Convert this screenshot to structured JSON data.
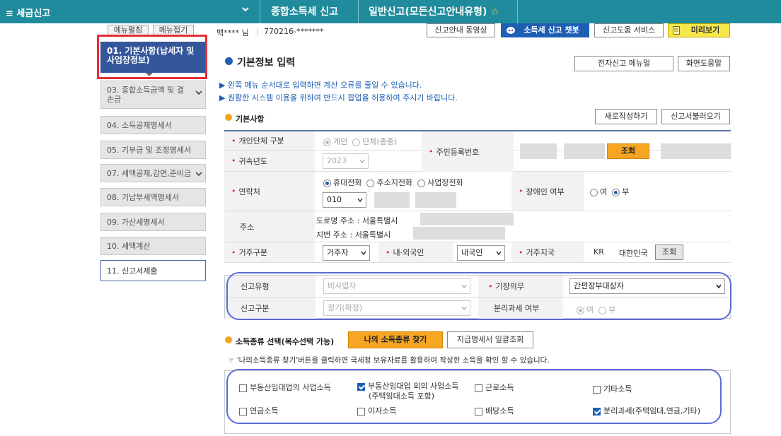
{
  "topbar": {
    "menu_label": "≡  세금신고",
    "crumb1": "종합소득세 신고",
    "crumb2": "일반신고(모든신고안내유형)",
    "star": "☆"
  },
  "sidebar": {
    "top_btn1": "메뉴펼침",
    "top_btn2": "메뉴접기",
    "items": [
      {
        "label": "01. 기본사항(납세자 및 사업장정보)"
      },
      {
        "label": "03. 종합소득금액 및 결손금"
      },
      {
        "label": "04. 소득공제명세서"
      },
      {
        "label": "05. 기부금 및 조정명세서"
      },
      {
        "label": "07. 세액공제,감면,준비금"
      },
      {
        "label": "08. 기납부세액명세서"
      },
      {
        "label": "09. 가산세명세서"
      },
      {
        "label": "10. 세액계산"
      },
      {
        "label": "11. 신고서제출"
      }
    ]
  },
  "header": {
    "user": "백**** 님",
    "id": "770216-*******",
    "btn_video": "신고안내 동영상",
    "btn_chatbot": "소득세 신고 챗봇",
    "btn_help_service": "신고도움 서비스",
    "btn_preview": "미리보기"
  },
  "main": {
    "title": "기본정보 입력",
    "btn_manual": "전자신고 메뉴얼",
    "btn_screen_help": "화면도움말",
    "note1": "▶ 왼쪽 메뉴 순서대로 입력하면 계산 오류를 줄일 수 있습니다.",
    "note2": "▶ 원활한 시스템 이용을 위하여 반드시 팝업을 허용하여 주시기 바랍니다.",
    "basic_title": "기본사항",
    "btn_new": "새로작성하기",
    "btn_load": "신고서불러오기"
  },
  "form": {
    "lbl_type": "개인단체 구분",
    "opt_individual": "개인",
    "opt_group": "단체(종중)",
    "lbl_rrn": "주민등록번호",
    "btn_lookup": "조회",
    "lbl_year": "귀속년도",
    "year_value": "2023",
    "lbl_contact": "연락처",
    "opt_mobile": "휴대전화",
    "opt_home": "주소지전화",
    "opt_business": "사업장전화",
    "phone_prefix": "010",
    "lbl_disabled": "장애인 여부",
    "opt_yes": "여",
    "opt_no": "부",
    "lbl_address": "주소",
    "road_addr_label": "도로명 주소 :",
    "road_addr_value": "서울특별시",
    "lot_addr_label": "지번 주소 :",
    "lot_addr_value": "서울특별시",
    "lbl_residence": "거주구분",
    "residence_value": "거주자",
    "lbl_nationality": "내·외국인",
    "nationality_value": "내국인",
    "lbl_country": "거주지국",
    "country_code": "KR",
    "country_name": "대한민국",
    "btn_country_lookup": "조회"
  },
  "report": {
    "lbl_report_type": "신고유형",
    "report_type_value": "비사업자",
    "lbl_bookkeeping": "기장의무",
    "bookkeeping_value": "간편장부대상자",
    "lbl_report_kind": "신고구분",
    "report_kind_value": "정기(확정)",
    "lbl_separate": "분리과세 여부",
    "opt_yes": "여",
    "opt_no": "부"
  },
  "income": {
    "title": "소득종류 선택(복수선택 가능)",
    "btn_find": "나의 소득종류 찾기",
    "btn_statements": "지급명세서 일괄조회",
    "hint": "☞ '나의소득종류 찾기'버튼을 클릭하면 국세청 보유자료를 활용하여 작성한 소득을 확인 할 수 있습니다.",
    "opt_rental_business": "부동산임대업의 사업소득",
    "opt_other_business": "부동산임대업 외의 사업소득",
    "opt_other_business_sub": "(주택임대소득 포함)",
    "opt_wage": "근로소득",
    "opt_other": "기타소득",
    "opt_pension": "연금소득",
    "opt_interest": "이자소득",
    "opt_dividend": "배당소득",
    "opt_separate": "분리과세(주택임대,연금,기타)"
  }
}
